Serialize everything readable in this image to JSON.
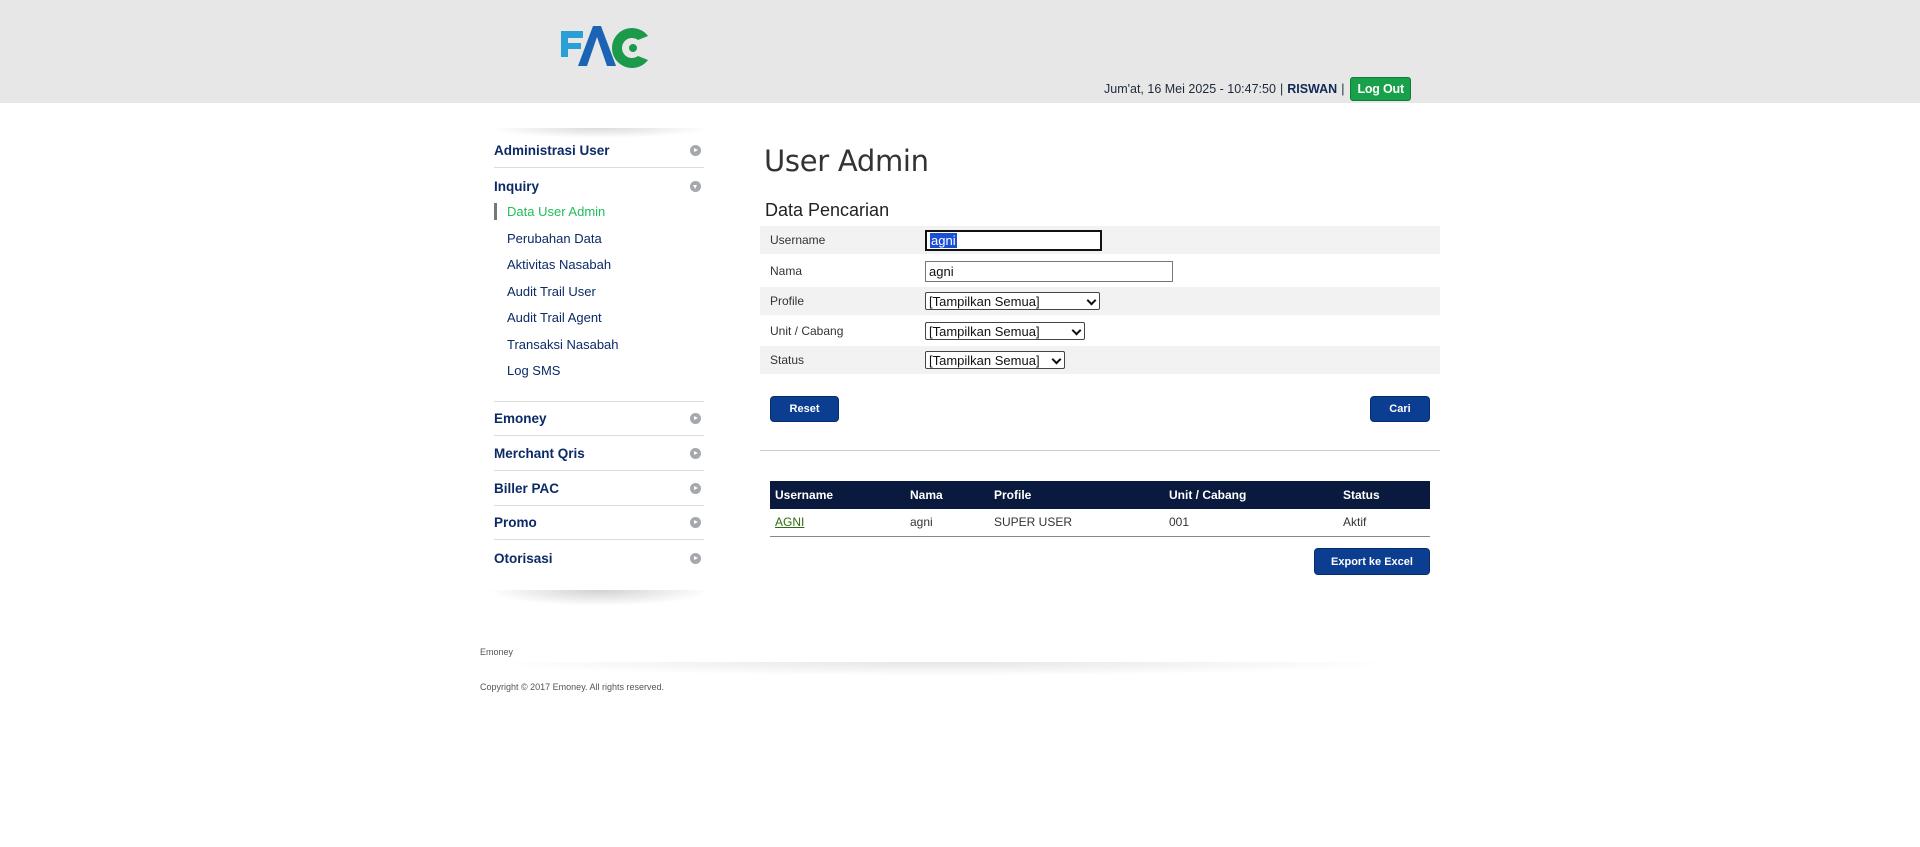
{
  "header": {
    "logo_text": "PAC",
    "datetime": "Jum'at, 16 Mei 2025 - 10:47:50",
    "separator": "|",
    "username": "RISWAN",
    "logout_label": "Log Out",
    "colors": {
      "background": "#e8e7e8",
      "logout": "#18a04a"
    }
  },
  "sidebar": {
    "menus": [
      {
        "label": "Administrasi User",
        "state": "collapsed"
      },
      {
        "label": "Inquiry",
        "state": "expanded"
      },
      {
        "label": "Emoney",
        "state": "collapsed"
      },
      {
        "label": "Merchant Qris",
        "state": "collapsed"
      },
      {
        "label": "Biller PAC",
        "state": "collapsed"
      },
      {
        "label": "Promo",
        "state": "collapsed"
      },
      {
        "label": "Otorisasi",
        "state": "collapsed"
      }
    ],
    "inquiry_items": [
      {
        "label": "Data User Admin",
        "active": true
      },
      {
        "label": "Perubahan Data"
      },
      {
        "label": "Aktivitas Nasabah"
      },
      {
        "label": "Audit Trail User"
      },
      {
        "label": "Audit Trail Agent"
      },
      {
        "label": "Transaksi Nasabah"
      },
      {
        "label": "Log SMS"
      }
    ]
  },
  "main": {
    "title": "User Admin",
    "search": {
      "heading": "Data Pencarian",
      "fields": {
        "username": {
          "label": "Username",
          "value": "agni"
        },
        "nama": {
          "label": "Nama",
          "value": "agni"
        },
        "profile": {
          "label": "Profile",
          "selected": "[Tampilkan Semua]"
        },
        "unit": {
          "label": "Unit / Cabang",
          "selected": "[Tampilkan Semua]"
        },
        "status": {
          "label": "Status",
          "selected": "[Tampilkan Semua]"
        }
      },
      "reset_label": "Reset",
      "search_label": "Cari"
    },
    "results": {
      "columns": [
        "Username",
        "Nama",
        "Profile",
        "Unit / Cabang",
        "Status"
      ],
      "rows": [
        {
          "username": "AGNI",
          "nama": "agni",
          "profile": "SUPER USER",
          "unit": "001",
          "status": "Aktif"
        }
      ],
      "export_label": "Export ke Excel"
    }
  },
  "footer": {
    "name": "Emoney",
    "copyright": "Copyright © 2017 Emoney. All rights reserved."
  }
}
